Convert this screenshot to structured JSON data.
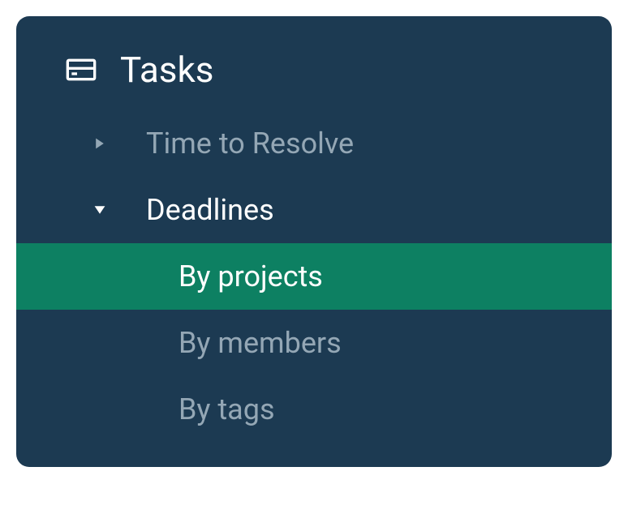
{
  "section": {
    "title": "Tasks"
  },
  "nav": {
    "items": [
      {
        "label": "Time to Resolve",
        "expanded": false,
        "level": 1
      },
      {
        "label": "Deadlines",
        "expanded": true,
        "level": 1
      },
      {
        "label": "By projects",
        "selected": true,
        "level": 2
      },
      {
        "label": "By members",
        "selected": false,
        "level": 2
      },
      {
        "label": "By tags",
        "selected": false,
        "level": 2
      }
    ]
  }
}
